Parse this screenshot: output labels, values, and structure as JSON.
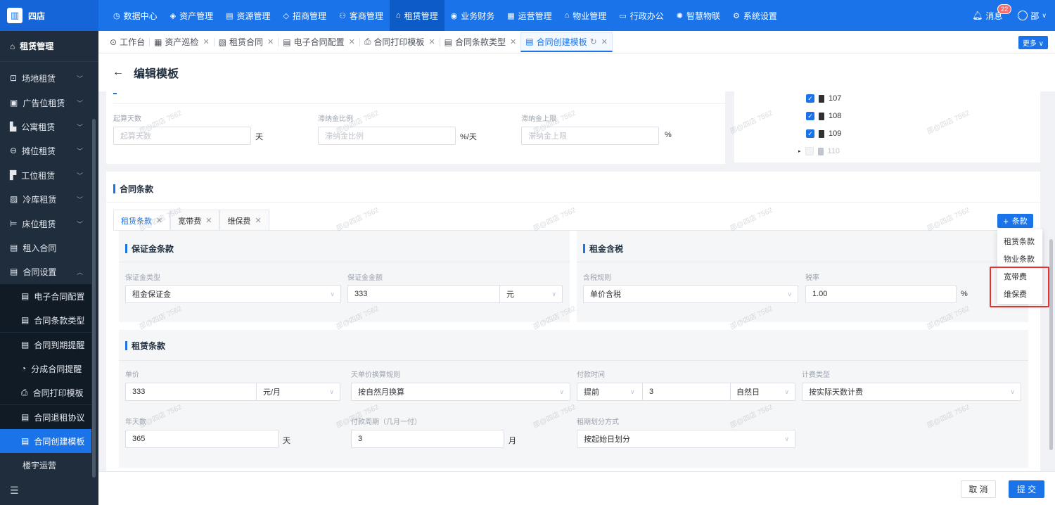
{
  "app": {
    "logo_text": "四店"
  },
  "topnav": [
    {
      "label": "数据中心",
      "icon": "clock-icon"
    },
    {
      "label": "资产管理",
      "icon": "cube-icon"
    },
    {
      "label": "资源管理",
      "icon": "chart-icon"
    },
    {
      "label": "招商管理",
      "icon": "tag-icon"
    },
    {
      "label": "客商管理",
      "icon": "users-icon"
    },
    {
      "label": "租赁管理",
      "icon": "home-icon",
      "active": true
    },
    {
      "label": "业务财务",
      "icon": "coin-icon"
    },
    {
      "label": "运营管理",
      "icon": "grid-icon"
    },
    {
      "label": "物业管理",
      "icon": "building-icon"
    },
    {
      "label": "行政办公",
      "icon": "monitor-icon"
    },
    {
      "label": "智慧物联",
      "icon": "iot-icon"
    },
    {
      "label": "系统设置",
      "icon": "gear-icon"
    }
  ],
  "header_right": {
    "messages_label": "消息",
    "messages_count": "22",
    "user_label": "邵"
  },
  "sidebar": {
    "title": "租赁管理",
    "items": [
      {
        "label": "场地租赁",
        "chevron": "﹀"
      },
      {
        "label": "广告位租赁",
        "chevron": "﹀"
      },
      {
        "label": "公寓租赁",
        "chevron": "﹀"
      },
      {
        "label": "摊位租赁",
        "chevron": "﹀"
      },
      {
        "label": "工位租赁",
        "chevron": "﹀"
      },
      {
        "label": "冷库租赁",
        "chevron": "﹀"
      },
      {
        "label": "床位租赁",
        "chevron": "﹀"
      },
      {
        "label": "租入合同",
        "chevron": ""
      },
      {
        "label": "合同设置",
        "chevron": "︿"
      }
    ],
    "subitems": [
      {
        "label": "电子合同配置"
      },
      {
        "label": "合同条款类型"
      },
      {
        "label": "合同到期提醒"
      },
      {
        "label": "分成合同提醒"
      },
      {
        "label": "合同打印模板"
      },
      {
        "label": "合同退租协议"
      },
      {
        "label": "合同创建模板",
        "active": true
      }
    ],
    "last_item": "楼宇运营"
  },
  "tabs": [
    {
      "label": "工作台",
      "closable": false
    },
    {
      "label": "资产巡检",
      "closable": true
    },
    {
      "label": "租赁合同",
      "closable": true
    },
    {
      "label": "电子合同配置",
      "closable": true
    },
    {
      "label": "合同打印模板",
      "closable": true
    },
    {
      "label": "合同条款类型",
      "closable": true
    },
    {
      "label": "合同创建模板",
      "closable": true,
      "active": true
    }
  ],
  "more_label": "更多 ∨",
  "page": {
    "title": "编辑模板"
  },
  "top_form": {
    "start_days": {
      "label": "起算天数",
      "placeholder": "起算天数",
      "unit": "天"
    },
    "late_fee_ratio": {
      "label": "滞纳金比例",
      "placeholder": "滞纳金比例",
      "unit": "%/天"
    },
    "late_fee_cap": {
      "label": "滞纳金上限",
      "placeholder": "滞纳金上限",
      "unit": "%"
    }
  },
  "tree": [
    {
      "label": "107",
      "checked": true
    },
    {
      "label": "108",
      "checked": true
    },
    {
      "label": "109",
      "checked": true
    },
    {
      "label": "110",
      "checked": false
    }
  ],
  "terms_section": {
    "title": "合同条款"
  },
  "contract_tabs": [
    {
      "label": "租赁条款",
      "active": true
    },
    {
      "label": "宽带费"
    },
    {
      "label": "维保费"
    }
  ],
  "add_button": "条款",
  "add_menu": [
    "租赁条款",
    "物业条款",
    "宽带费",
    "维保费"
  ],
  "deposit": {
    "title": "保证金条款",
    "type_label": "保证金类型",
    "type_value": "租金保证金",
    "amount_label": "保证金金额",
    "amount_value": "333",
    "amount_unit": "元"
  },
  "tax": {
    "title": "租金含税",
    "rule_label": "含税规则",
    "rule_value": "单价含税",
    "rate_label": "税率",
    "rate_value": "1.00",
    "rate_unit": "%"
  },
  "lease": {
    "title": "租赁条款",
    "unit_price_label": "单价",
    "unit_price_value": "333",
    "unit_price_unit": "元/月",
    "conversion_label": "天单价换算规则",
    "conversion_value": "按自然月换算",
    "pay_time_label": "付款时间",
    "pay_time_mode": "提前",
    "pay_time_days": "3",
    "pay_time_unit": "自然日",
    "billing_label": "计费类型",
    "billing_value": "按实际天数计费",
    "year_days_label": "年天数",
    "year_days_value": "365",
    "year_days_unit": "天",
    "cycle_label": "付款周期（几月一付）",
    "cycle_value": "3",
    "cycle_unit": "月",
    "period_label": "租期划分方式",
    "period_value": "按起始日划分"
  },
  "footer": {
    "cancel": "取 消",
    "submit": "提 交"
  },
  "watermark": "邵@四店 7562",
  "colors": {
    "primary": "#1a73e8",
    "sidebar": "#1f2d3d",
    "highlight": "#e5312f"
  }
}
